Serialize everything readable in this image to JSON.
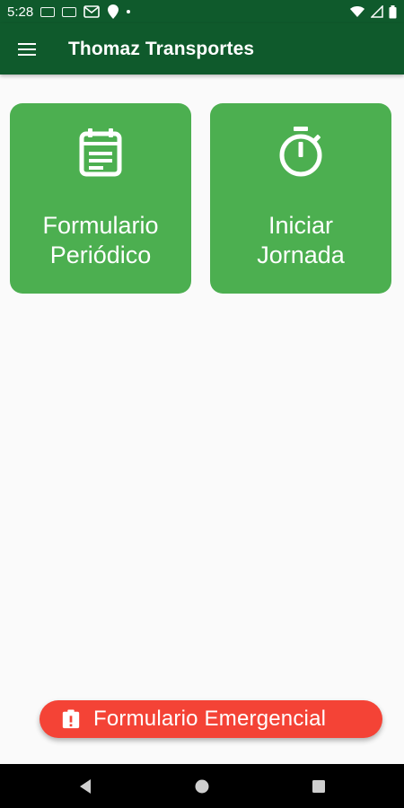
{
  "status_bar": {
    "time": "5:28",
    "icons": [
      "notification-icon",
      "notification-icon",
      "gmail-icon",
      "location-icon",
      "dot-icon",
      "wifi-icon",
      "signal-icon",
      "battery-icon"
    ]
  },
  "app_bar": {
    "title": "Thomaz Transportes",
    "menu_icon": "hamburger-menu-icon"
  },
  "tiles": [
    {
      "label_line1": "Formulario",
      "label_line2": "Periódico",
      "icon": "form-clipboard-icon"
    },
    {
      "label_line1": "Iniciar",
      "label_line2": "Jornada",
      "icon": "stopwatch-icon"
    }
  ],
  "fab": {
    "label": "Formulario Emergencial",
    "icon": "alert-clipboard-icon"
  },
  "colors": {
    "primary_dark": "#0f5a2c",
    "tile_green": "#4caf50",
    "fab_red": "#f44336",
    "background": "#fafafa"
  }
}
